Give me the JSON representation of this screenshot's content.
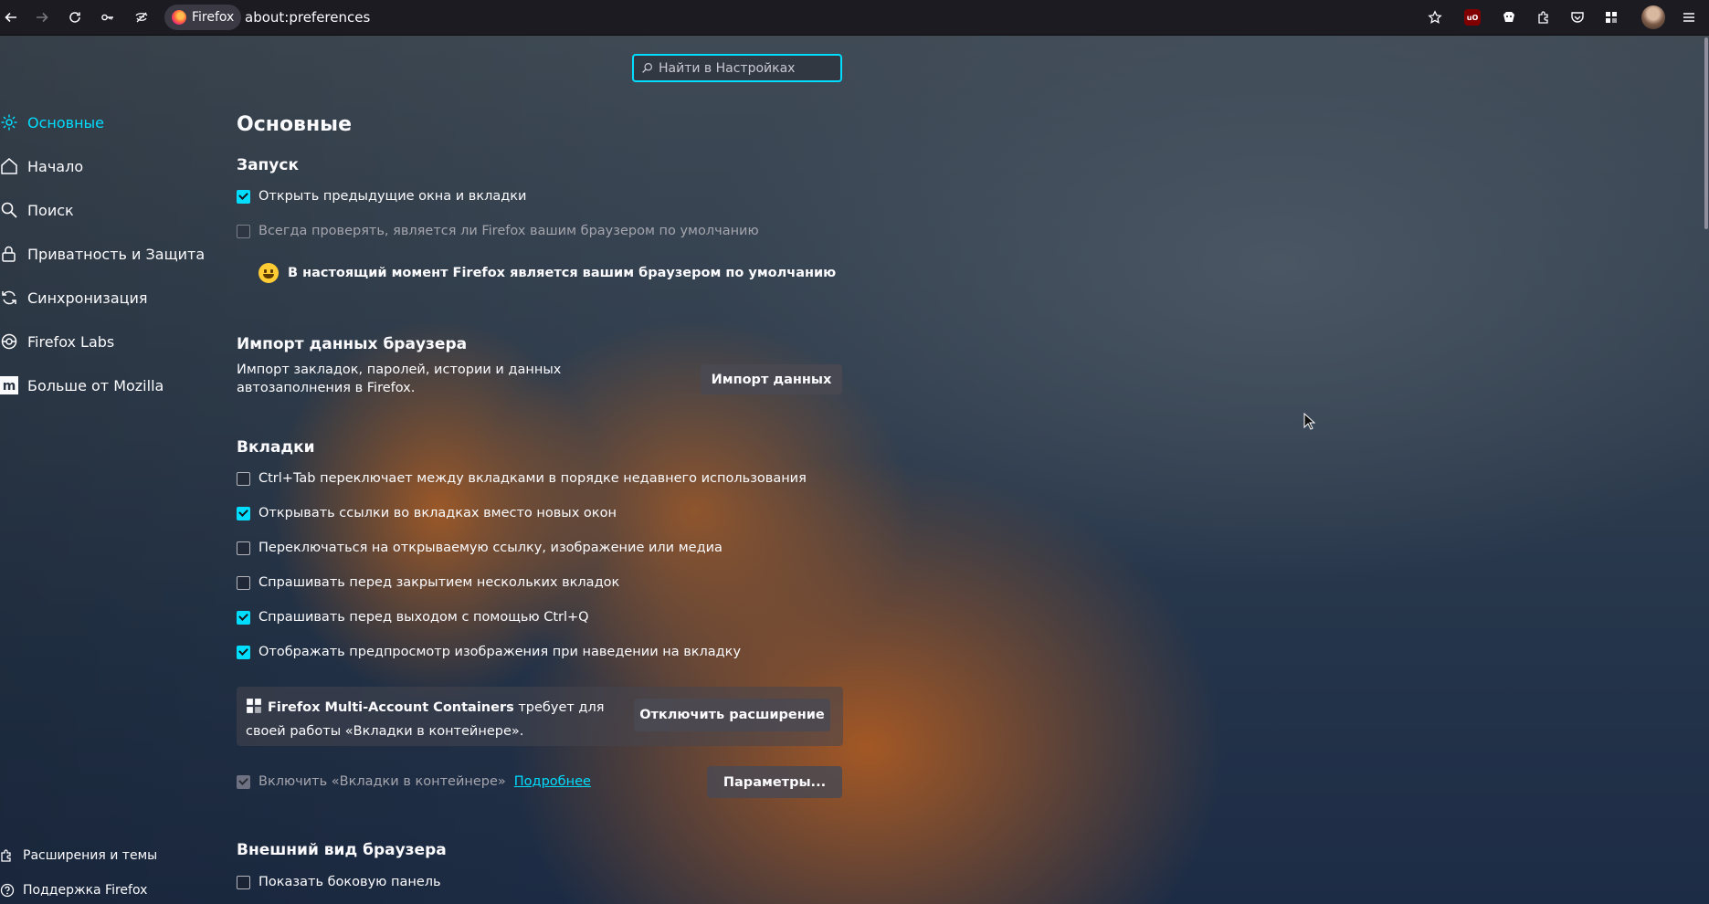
{
  "toolbar": {
    "identity_label": "Firefox",
    "url": "about:preferences",
    "icons": [
      "back-icon",
      "forward-icon",
      "reload-icon",
      "key-icon",
      "tracking-icon",
      "bookmark-star-icon",
      "ublock-icon",
      "privacy-badger-icon",
      "extensions-icon",
      "pocket-icon",
      "containers-icon",
      "avatar",
      "menu-icon"
    ],
    "ublock_label": "uO"
  },
  "search": {
    "placeholder": "Найти в Настройках"
  },
  "sidebar": {
    "items": [
      {
        "label": "Основные",
        "icon": "gear-icon",
        "active": true
      },
      {
        "label": "Начало",
        "icon": "home-icon"
      },
      {
        "label": "Поиск",
        "icon": "search-icon"
      },
      {
        "label": "Приватность и Защита",
        "icon": "lock-icon"
      },
      {
        "label": "Синхронизация",
        "icon": "sync-icon"
      },
      {
        "label": "Firefox Labs",
        "icon": "labs-icon"
      },
      {
        "label": "Больше от Mozilla",
        "icon": "mozilla-icon"
      }
    ],
    "footer": [
      {
        "label": "Расширения и темы",
        "icon": "puzzle-icon"
      },
      {
        "label": "Поддержка Firefox",
        "icon": "help-icon"
      }
    ]
  },
  "main": {
    "title": "Основные",
    "startup": {
      "heading": "Запуск",
      "restore_session": "Открыть предыдущие окна и вкладки",
      "check_default": "Всегда проверять, является ли Firefox вашим браузером по умолчанию",
      "default_status": "В настоящий момент Firefox является вашим браузером по умолчанию"
    },
    "import": {
      "heading": "Импорт данных браузера",
      "description": "Импорт закладок, паролей, истории и данных автозаполнения в Firefox.",
      "button": "Импорт данных"
    },
    "tabs": {
      "heading": "Вкладки",
      "options": [
        {
          "label": "Ctrl+Tab переключает между вкладками в порядке недавнего использования",
          "checked": false
        },
        {
          "label": "Открывать ссылки во вкладках вместо новых окон",
          "checked": true
        },
        {
          "label": "Переключаться на открываемую ссылку, изображение или медиа",
          "checked": false
        },
        {
          "label": "Спрашивать перед закрытием нескольких вкладок",
          "checked": false
        },
        {
          "label": "Спрашивать перед выходом с помощью Ctrl+Q",
          "checked": true
        },
        {
          "label": "Отображать предпросмотр изображения при наведении на вкладку",
          "checked": true
        }
      ],
      "containers_notice_bold": "Firefox Multi-Account Containers",
      "containers_notice_rest": " требует для своей работы «Вкладки в контейнере».",
      "disable_extension_button": "Отключить расширение",
      "containers_label": "Включить «Вкладки в контейнере»",
      "learn_more": "Подробнее",
      "settings_button": "Параметры..."
    },
    "appearance": {
      "heading": "Внешний вид браузера",
      "show_sidebar": "Показать боковую панель"
    }
  },
  "colors": {
    "accent": "#00ddff",
    "toolbar_bg": "#1c1b22",
    "text": "#fbfbfe"
  }
}
